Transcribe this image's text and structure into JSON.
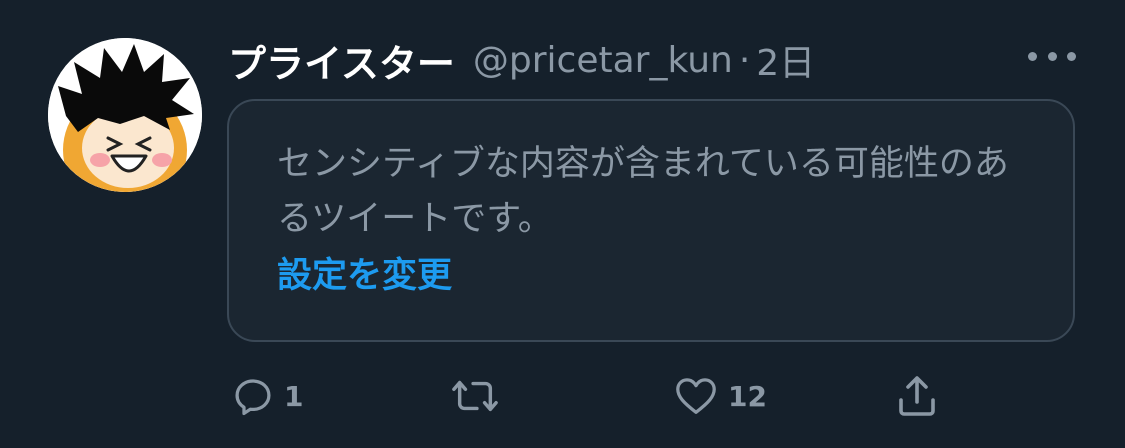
{
  "user": {
    "display_name": "プライスター",
    "handle": "@pricetar_kun",
    "separator": "·",
    "time": "2日"
  },
  "notice": {
    "message": "センシティブな内容が含まれている可能性のあるツイートです。",
    "link_label": "設定を変更"
  },
  "actions": {
    "reply_count": "1",
    "retweet_count": "",
    "like_count": "12"
  },
  "icons": {
    "more": "more-horizontal-icon",
    "reply": "reply-icon",
    "retweet": "retweet-icon",
    "like": "heart-icon",
    "share": "share-icon"
  },
  "colors": {
    "background": "#15202b",
    "secondary_text": "#8b98a5",
    "link": "#1d9bf0",
    "border": "#3a4856"
  }
}
